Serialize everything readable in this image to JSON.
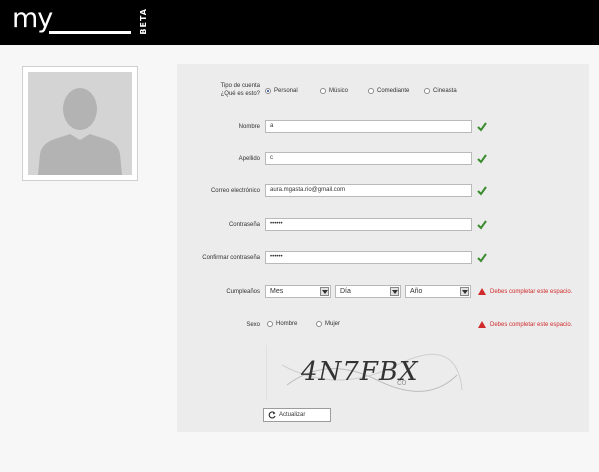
{
  "header": {
    "logo_text": "my",
    "beta_label": "BETA"
  },
  "form": {
    "account_type_label_1": "Tipo de cuenta",
    "account_type_label_2": "¿Qué es esto?",
    "account_type_options": [
      "Personal",
      "Músico",
      "Comediante",
      "Cineasta"
    ],
    "account_type_selected": "Personal",
    "name_label": "Nombre",
    "name_value": "a",
    "surname_label": "Apellido",
    "surname_value": "c",
    "email_label": "Correo electrónico",
    "email_value": "aura.mgasta.rio@gmail.com",
    "password_label": "Contraseña",
    "password_value": "••••••",
    "confirm_label": "Confirmar contraseña",
    "confirm_value": "••••••",
    "birthday_label": "Cumpleaños",
    "month_value": "Mes",
    "day_value": "Día",
    "year_value": "Año",
    "birthday_error": "Debes completar este espacio.",
    "sex_label": "Sexo",
    "sex_options": [
      "Hombre",
      "Mujer"
    ],
    "sex_error": "Debes completar este espacio.",
    "captcha_text": "4N7FBX",
    "captcha_sub": "co",
    "refresh_label": "Actualizar"
  },
  "colors": {
    "check": "#3a8a2e",
    "error": "#d12a2a",
    "topbar": "#000000"
  }
}
